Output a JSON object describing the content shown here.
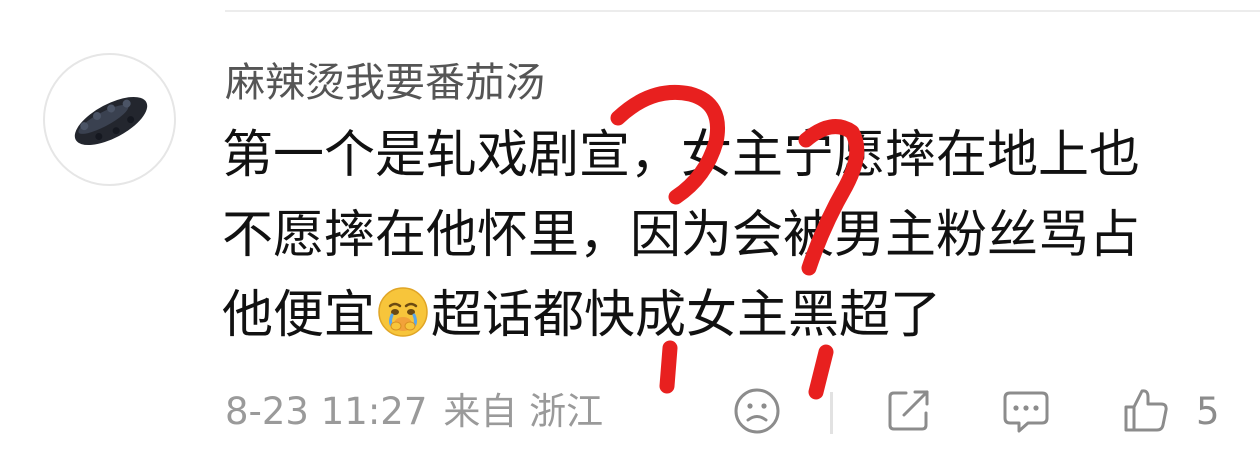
{
  "comment": {
    "username": "麻辣烫我要番茄汤",
    "text_lines": [
      "第一个是轧戏剧宣，女主宁愿摔在地上也",
      "不愿摔在他怀里，因为会被男主粉丝骂占"
    ],
    "text_line3_before": "他便宜",
    "text_line3_after": "超话都快成女主黑超了",
    "emoji": "crying-emoji",
    "date": "8-23 11:27",
    "source": "来自 浙江",
    "like_count": "5"
  },
  "icons": {
    "dislike": "sad-face-icon",
    "share": "share-icon",
    "reply": "comment-icon",
    "like": "thumbs-up-icon"
  },
  "colors": {
    "text": "#111111",
    "username": "#555555",
    "meta": "#9a9a9a",
    "icon": "#8c8c8c",
    "annotation": "#e8201f"
  }
}
